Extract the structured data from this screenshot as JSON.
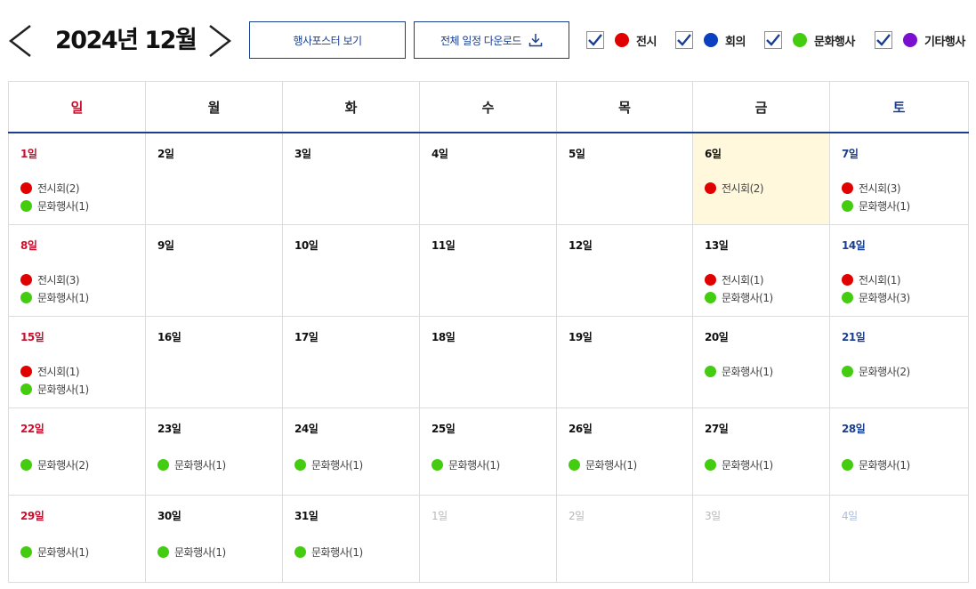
{
  "header": {
    "title": "2024년 12월",
    "prev_icon": "chevron-left-icon",
    "next_icon": "chevron-right-icon"
  },
  "buttons": {
    "poster_label": "행사포스터 보기",
    "download_label": "전체 일정 다운로드",
    "download_icon": "download-icon"
  },
  "filters": [
    {
      "label": "전시",
      "color": "#e00000",
      "checked": true
    },
    {
      "label": "회의",
      "color": "#0a3fbf",
      "checked": true
    },
    {
      "label": "문화행사",
      "color": "#44cc11",
      "checked": true
    },
    {
      "label": "기타행사",
      "color": "#7a0fd0",
      "checked": true
    }
  ],
  "colors": {
    "exhibition": "#e00000",
    "meeting": "#0a3fbf",
    "culture": "#44cc11",
    "etc": "#7a0fd0",
    "accent": "#1b3f8f",
    "sunday": "#c8102e",
    "today_bg": "#fff8dc"
  },
  "weekdays": [
    "일",
    "월",
    "화",
    "수",
    "목",
    "금",
    "토"
  ],
  "weeks": [
    [
      {
        "day": "1일",
        "events": [
          {
            "label": "전시회(2)",
            "type": "exhibition"
          },
          {
            "label": "문화행사(1)",
            "type": "culture"
          }
        ]
      },
      {
        "day": "2일",
        "events": []
      },
      {
        "day": "3일",
        "events": []
      },
      {
        "day": "4일",
        "events": []
      },
      {
        "day": "5일",
        "events": []
      },
      {
        "day": "6일",
        "today": true,
        "events": [
          {
            "label": "전시회(2)",
            "type": "exhibition"
          }
        ]
      },
      {
        "day": "7일",
        "events": [
          {
            "label": "전시회(3)",
            "type": "exhibition"
          },
          {
            "label": "문화행사(1)",
            "type": "culture"
          }
        ]
      }
    ],
    [
      {
        "day": "8일",
        "events": [
          {
            "label": "전시회(3)",
            "type": "exhibition"
          },
          {
            "label": "문화행사(1)",
            "type": "culture"
          }
        ]
      },
      {
        "day": "9일",
        "events": []
      },
      {
        "day": "10일",
        "events": []
      },
      {
        "day": "11일",
        "events": []
      },
      {
        "day": "12일",
        "events": []
      },
      {
        "day": "13일",
        "events": [
          {
            "label": "전시회(1)",
            "type": "exhibition"
          },
          {
            "label": "문화행사(1)",
            "type": "culture"
          }
        ]
      },
      {
        "day": "14일",
        "events": [
          {
            "label": "전시회(1)",
            "type": "exhibition"
          },
          {
            "label": "문화행사(3)",
            "type": "culture"
          }
        ]
      }
    ],
    [
      {
        "day": "15일",
        "events": [
          {
            "label": "전시회(1)",
            "type": "exhibition"
          },
          {
            "label": "문화행사(1)",
            "type": "culture"
          }
        ]
      },
      {
        "day": "16일",
        "events": []
      },
      {
        "day": "17일",
        "events": []
      },
      {
        "day": "18일",
        "events": []
      },
      {
        "day": "19일",
        "events": []
      },
      {
        "day": "20일",
        "events": [
          {
            "label": "문화행사(1)",
            "type": "culture"
          }
        ]
      },
      {
        "day": "21일",
        "events": [
          {
            "label": "문화행사(2)",
            "type": "culture"
          }
        ]
      }
    ],
    [
      {
        "day": "22일",
        "events": [
          {
            "label": "문화행사(2)",
            "type": "culture"
          }
        ]
      },
      {
        "day": "23일",
        "events": [
          {
            "label": "문화행사(1)",
            "type": "culture"
          }
        ]
      },
      {
        "day": "24일",
        "events": [
          {
            "label": "문화행사(1)",
            "type": "culture"
          }
        ]
      },
      {
        "day": "25일",
        "events": [
          {
            "label": "문화행사(1)",
            "type": "culture"
          }
        ]
      },
      {
        "day": "26일",
        "events": [
          {
            "label": "문화행사(1)",
            "type": "culture"
          }
        ]
      },
      {
        "day": "27일",
        "events": [
          {
            "label": "문화행사(1)",
            "type": "culture"
          }
        ]
      },
      {
        "day": "28일",
        "events": [
          {
            "label": "문화행사(1)",
            "type": "culture"
          }
        ]
      }
    ],
    [
      {
        "day": "29일",
        "events": [
          {
            "label": "문화행사(1)",
            "type": "culture"
          }
        ]
      },
      {
        "day": "30일",
        "events": [
          {
            "label": "문화행사(1)",
            "type": "culture"
          }
        ]
      },
      {
        "day": "31일",
        "events": [
          {
            "label": "문화행사(1)",
            "type": "culture"
          }
        ]
      },
      {
        "day": "1일",
        "other": true,
        "events": []
      },
      {
        "day": "2일",
        "other": true,
        "events": []
      },
      {
        "day": "3일",
        "other": true,
        "events": []
      },
      {
        "day": "4일",
        "other": true,
        "events": []
      }
    ]
  ]
}
